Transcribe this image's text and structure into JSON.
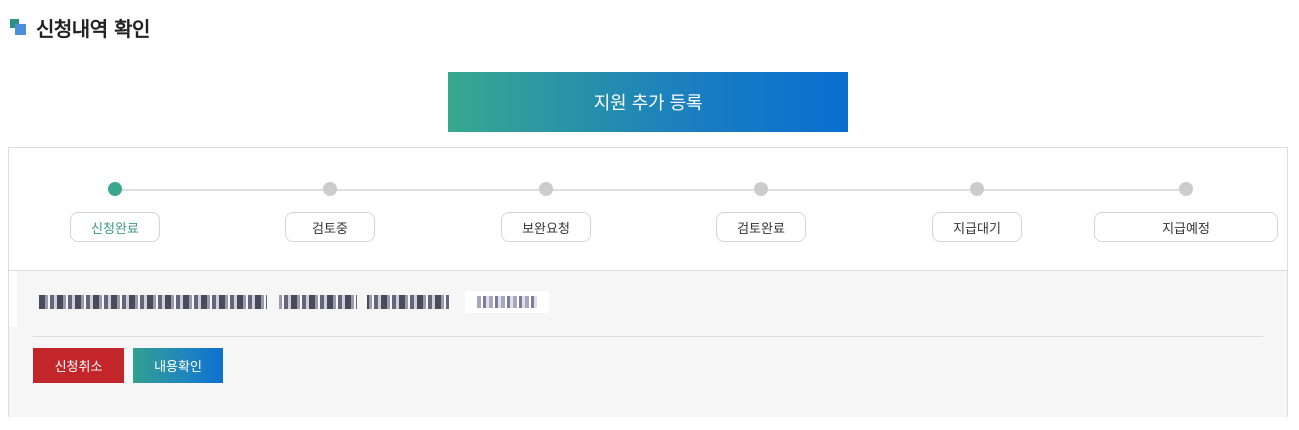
{
  "header": {
    "title": "신청내역 확인",
    "icon": "square-bullet-icon"
  },
  "add_support_button": {
    "label": "지원 추가 등록"
  },
  "progress": {
    "active_step_index": 0,
    "steps": [
      {
        "label": "신청완료"
      },
      {
        "label": "검토중"
      },
      {
        "label": "보완요청"
      },
      {
        "label": "검토완료"
      },
      {
        "label": "지급대기"
      },
      {
        "label": "지급예정"
      }
    ]
  },
  "actions": {
    "cancel_label": "신청취소",
    "view_label": "내용확인"
  },
  "colors": {
    "active_step": "#3aa890",
    "inactive_step": "#cccccc",
    "cancel_button": "#c3262a",
    "gradient_start": "#38a88f",
    "gradient_end": "#0a6ed1"
  }
}
